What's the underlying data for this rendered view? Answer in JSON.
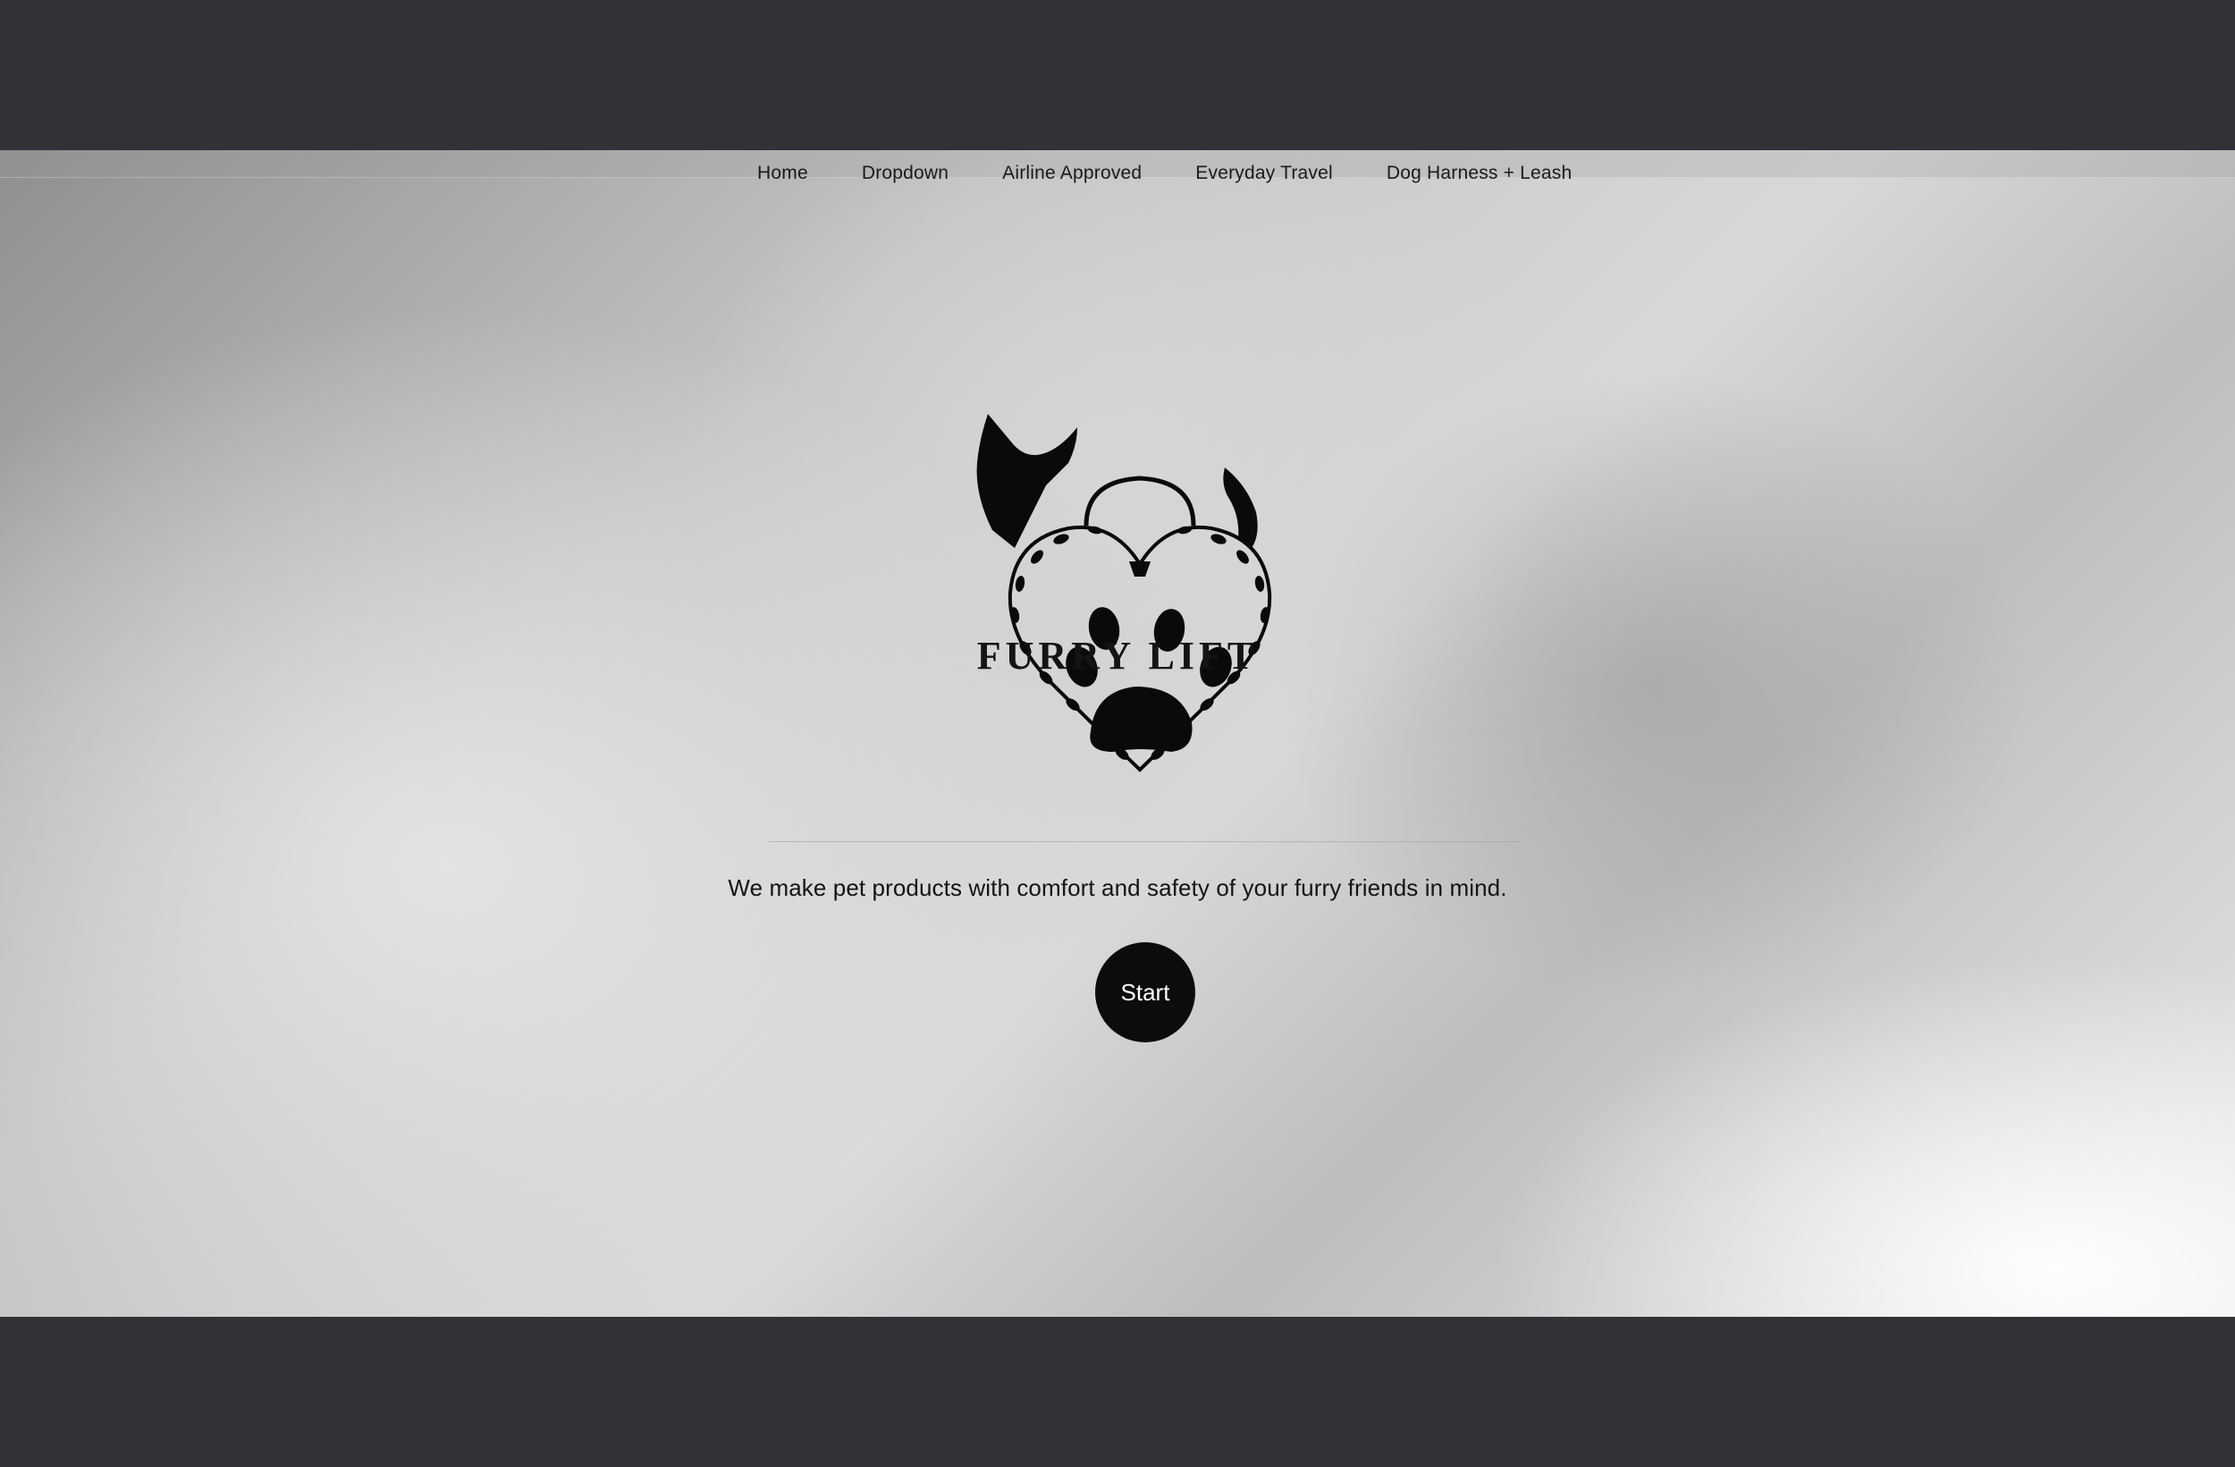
{
  "nav": {
    "items": [
      {
        "label": "Home"
      },
      {
        "label": "Dropdown"
      },
      {
        "label": "Airline Approved"
      },
      {
        "label": "Everyday Travel"
      },
      {
        "label": "Dog Harness + Leash"
      }
    ]
  },
  "hero": {
    "brand_name": "FURRY LIFT",
    "tagline": "We make pet products with comfort and safety of your furry friends in mind.",
    "cta_label": "Start"
  },
  "colors": {
    "frame_background": "#313238",
    "button_background": "#0c0c0c",
    "button_text": "#ffffff",
    "text": "#141414"
  },
  "icons": {
    "logo": "pet-heart-paw-logo"
  }
}
